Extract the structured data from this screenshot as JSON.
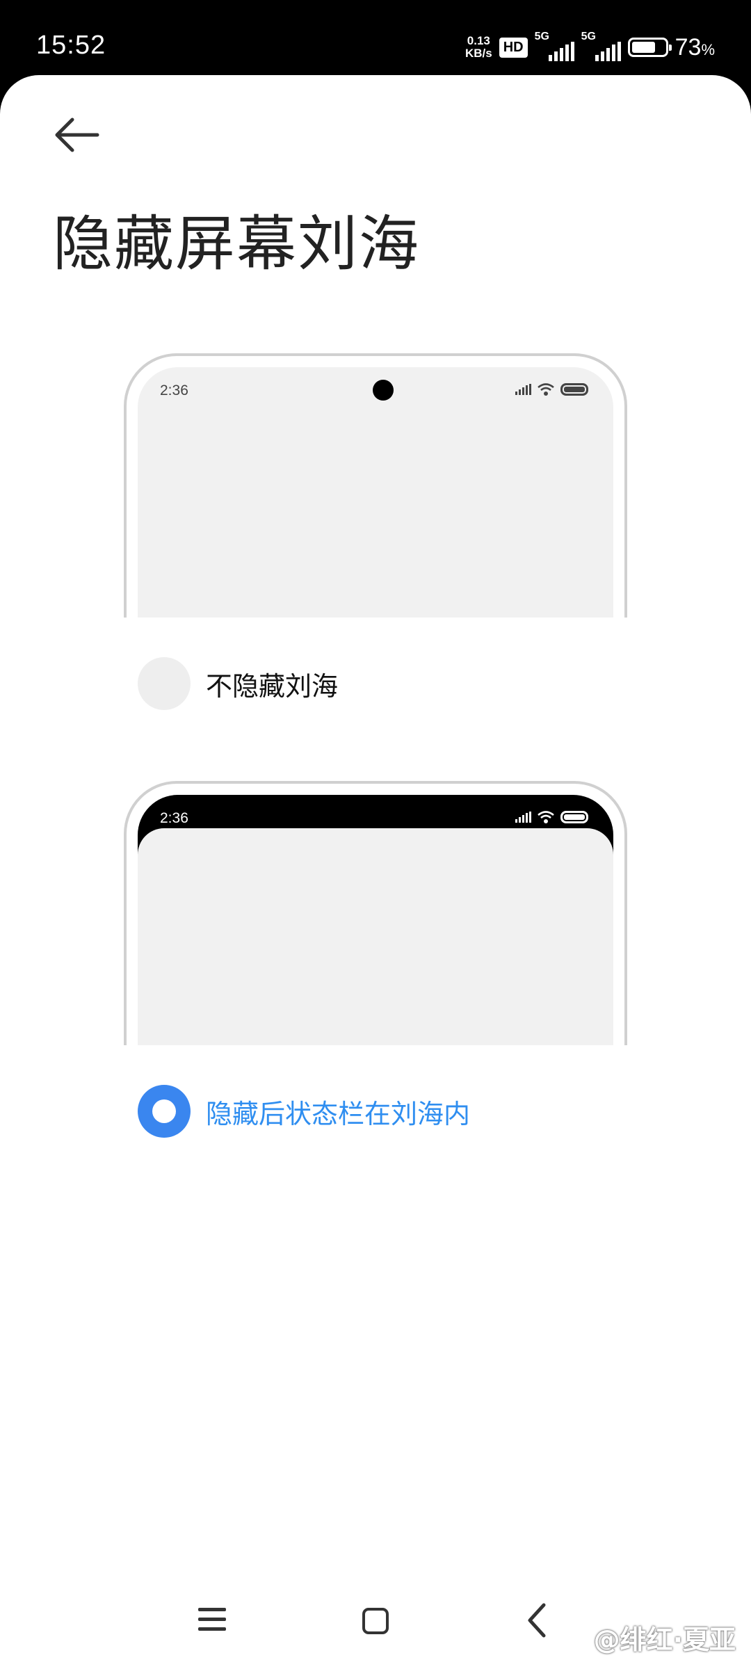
{
  "status_bar": {
    "time": "15:52",
    "net_speed_value": "0.13",
    "net_speed_unit": "KB/s",
    "hd_badge": "HD",
    "sim1": "5G",
    "sim2": "5G",
    "battery_level": 0.73,
    "battery_number": "73",
    "battery_percent_sign": "%"
  },
  "header": {
    "back_icon": "arrow-left-icon",
    "title": "隐藏屏幕刘海"
  },
  "options": [
    {
      "preview_time": "2:36",
      "label": "不隐藏刘海",
      "selected": false
    },
    {
      "preview_time": "2:36",
      "label": "隐藏后状态栏在刘海内",
      "selected": true
    }
  ],
  "colors": {
    "accent": "#3a86ef",
    "selected_text": "#2f8ef0",
    "preview_bg": "#f1f1f1"
  },
  "nav_bar": {
    "menu_icon": "menu-icon",
    "home_icon": "home-square-icon",
    "back_icon": "back-chevron-icon"
  },
  "watermark": "@绯红·夏亚"
}
